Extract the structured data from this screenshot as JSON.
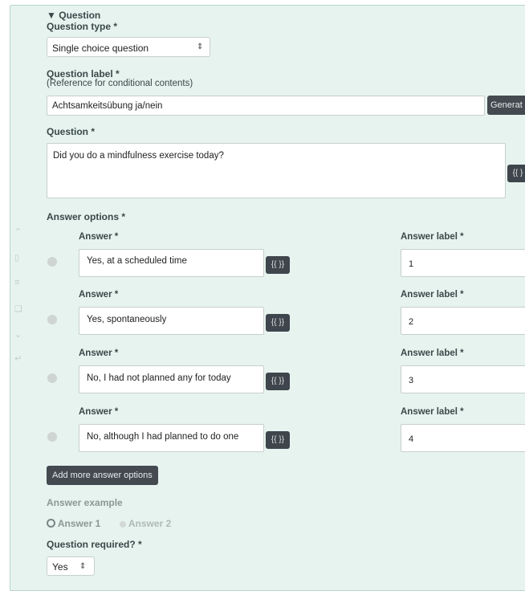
{
  "question_header": {
    "toggle_icon": "triangle-down-icon",
    "title": "Question"
  },
  "question_type": {
    "label": "Question type *",
    "value": "Single choice question"
  },
  "question_label": {
    "label": "Question label *",
    "sublabel": "(Reference for conditional contents)",
    "value": "Achtsamkeitsübung ja/nein",
    "generate_button": "Generat"
  },
  "question": {
    "label": "Question *",
    "value": "Did you do a mindfulness exercise today?",
    "template_button": "{{ }"
  },
  "answer_options": {
    "label": "Answer options *",
    "answer_heading": "Answer *",
    "answer_label_heading": "Answer label *",
    "template_button": "{{ }}",
    "items": [
      {
        "answer": "Yes, at a scheduled time",
        "answer_label": "1"
      },
      {
        "answer": "Yes, spontaneously",
        "answer_label": "2"
      },
      {
        "answer": "No, I had not planned any for today",
        "answer_label": "3"
      },
      {
        "answer": "No, although I had planned to do one",
        "answer_label": "4"
      }
    ],
    "add_more_button": "Add more answer options"
  },
  "answer_example": {
    "label": "Answer example",
    "options": [
      "Answer 1",
      "Answer 2"
    ],
    "selected": 0
  },
  "question_required": {
    "label": "Question required? *",
    "value": "Yes"
  },
  "side_toolbar": [
    "chevron-up-icon",
    "trash-icon",
    "list-icon",
    "copy-icon",
    "chevron-down-icon",
    "move-icon"
  ]
}
